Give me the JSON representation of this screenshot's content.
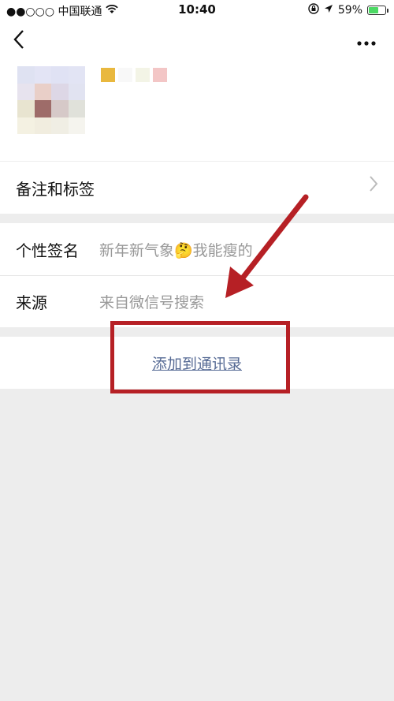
{
  "status_bar": {
    "carrier": "●●○○○ 中国联通",
    "time": "10:40",
    "battery_percent": "59%",
    "battery_level": 0.59
  },
  "header": {
    "back_icon": "chevron-left-icon",
    "more_icon": "more-dots-icon"
  },
  "rows_section1": {
    "remarks_label": "备注和标签"
  },
  "rows_section2": {
    "signature_label": "个性签名",
    "signature_value": "新年新气象🤔我能瘦的",
    "source_label": "来源",
    "source_value": "来自微信号搜索"
  },
  "action": {
    "add_to_contacts": "添加到通讯录"
  },
  "colors": {
    "link": "#576b95",
    "annotation_red": "#b62025",
    "background": "#ededed"
  }
}
